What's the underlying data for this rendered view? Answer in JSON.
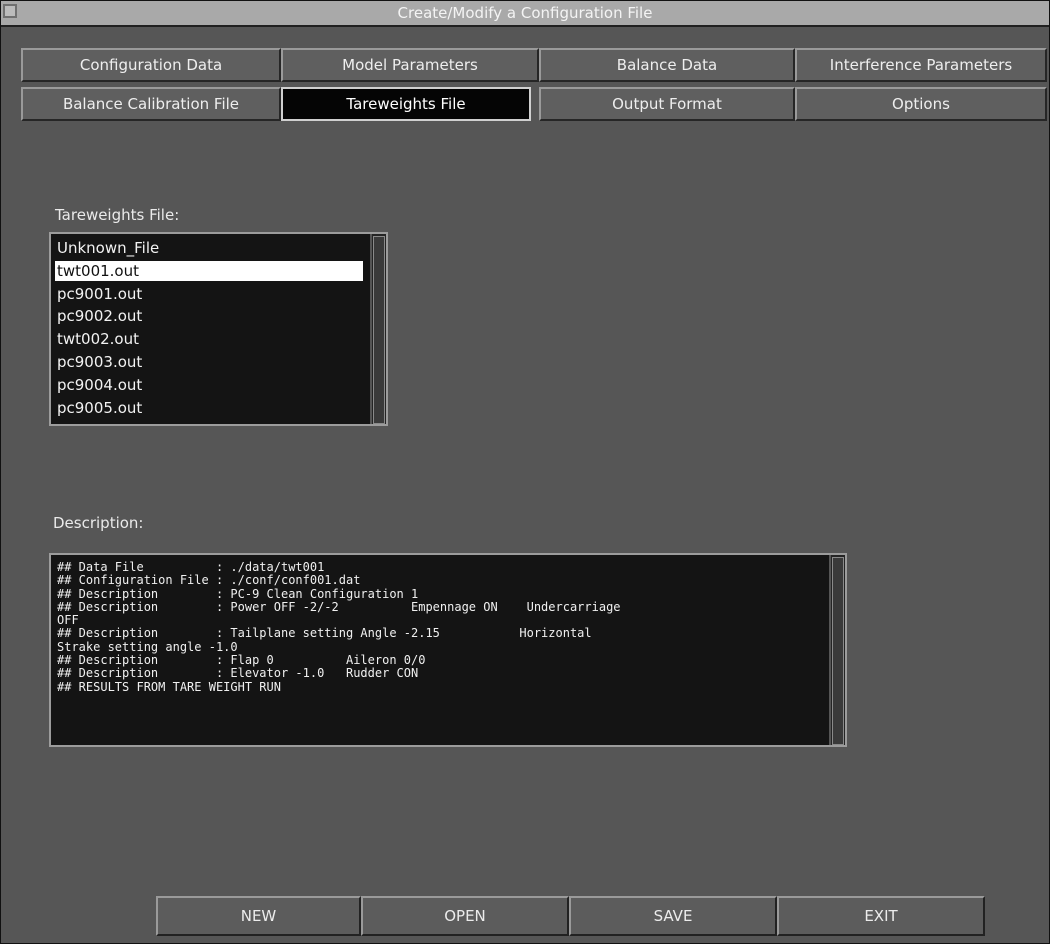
{
  "window": {
    "title": "Create/Modify a Configuration File"
  },
  "tabs_row1": [
    "Configuration Data",
    "Model Parameters",
    "Balance Data",
    "Interference Parameters"
  ],
  "tabs_row2": [
    "Balance Calibration File",
    "Tareweights File",
    "Output Format",
    "Options"
  ],
  "active_tab": "Tareweights File",
  "tareweights": {
    "label": "Tareweights File:",
    "files": [
      "Unknown_File",
      "twt001.out",
      "pc9001.out",
      "pc9002.out",
      "twt002.out",
      "pc9003.out",
      "pc9004.out",
      "pc9005.out"
    ],
    "selected": "twt001.out"
  },
  "description": {
    "label": "Description:",
    "text": "## Data File          : ./data/twt001\n## Configuration File : ./conf/conf001.dat\n## Description        : PC-9 Clean Configuration 1\n## Description        : Power OFF -2/-2          Empennage ON    Undercarriage\nOFF\n## Description        : Tailplane setting Angle -2.15           Horizontal\nStrake setting angle -1.0\n## Description        : Flap 0          Aileron 0/0\n## Description        : Elevator -1.0   Rudder CON\n## RESULTS FROM TARE WEIGHT RUN"
  },
  "buttons": {
    "new": "NEW",
    "open": "OPEN",
    "save": "SAVE",
    "exit": "EXIT"
  }
}
